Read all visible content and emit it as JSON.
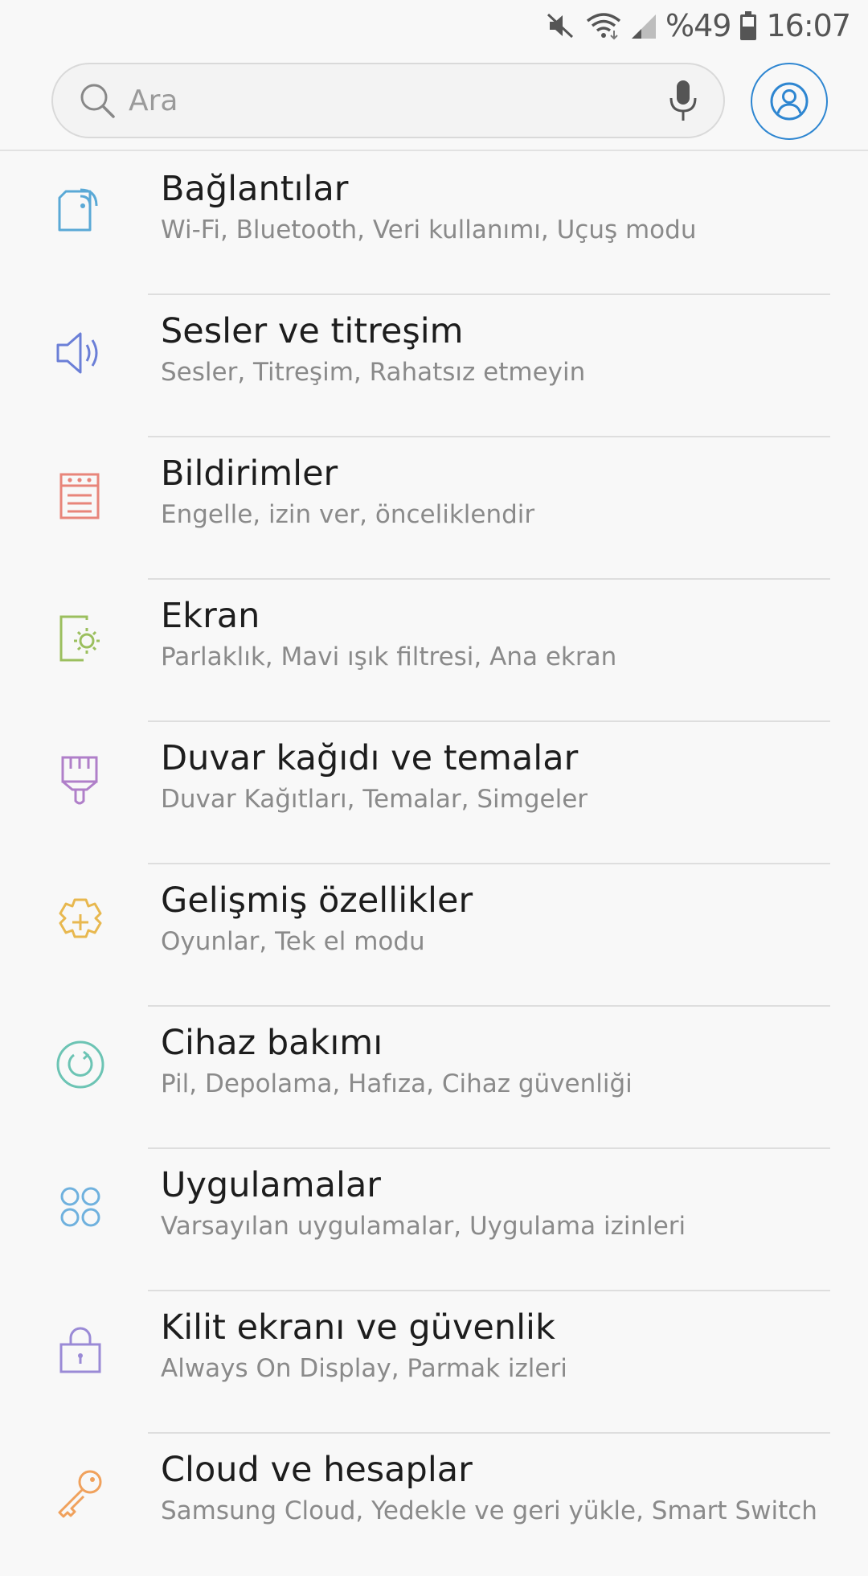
{
  "status_bar": {
    "battery_text": "%49",
    "time": "16:07",
    "icons": [
      "mute-icon",
      "wifi-icon",
      "signal-icon",
      "battery-icon"
    ]
  },
  "search": {
    "placeholder": "Ara",
    "icons": [
      "search-icon",
      "microphone-icon",
      "account-icon"
    ]
  },
  "colors": {
    "accent": "#2e86d1",
    "connections": "#5aa9d6",
    "sounds": "#6b7fd7",
    "notifications": "#e8857a",
    "display": "#9bbf5e",
    "wallpapers": "#b07fc9",
    "advanced": "#e8b84f",
    "device_care": "#6cc4b4",
    "apps": "#6fb1de",
    "lock_screen": "#9a8ad6",
    "cloud": "#f0a15c"
  },
  "settings": {
    "items": [
      {
        "title": "Bağlantılar",
        "subtitle": "Wi-Fi, Bluetooth, Veri kullanımı, Uçuş modu",
        "icon": "connections-icon"
      },
      {
        "title": "Sesler ve titreşim",
        "subtitle": "Sesler, Titreşim, Rahatsız etmeyin",
        "icon": "speaker-icon"
      },
      {
        "title": "Bildirimler",
        "subtitle": "Engelle, izin ver, önceliklendir",
        "icon": "notifications-icon"
      },
      {
        "title": "Ekran",
        "subtitle": "Parlaklık, Mavi ışık filtresi, Ana ekran",
        "icon": "display-brightness-icon"
      },
      {
        "title": "Duvar kağıdı ve temalar",
        "subtitle": "Duvar Kağıtları, Temalar, Simgeler",
        "icon": "paintbrush-icon"
      },
      {
        "title": "Gelişmiş özellikler",
        "subtitle": "Oyunlar, Tek el modu",
        "icon": "gear-plus-icon"
      },
      {
        "title": "Cihaz bakımı",
        "subtitle": "Pil, Depolama, Hafıza, Cihaz güvenliği",
        "icon": "device-care-icon"
      },
      {
        "title": "Uygulamalar",
        "subtitle": "Varsayılan uygulamalar, Uygulama izinleri",
        "icon": "apps-grid-icon"
      },
      {
        "title": "Kilit ekranı ve güvenlik",
        "subtitle": "Always On Display, Parmak izleri",
        "icon": "lock-icon"
      },
      {
        "title": "Cloud ve hesaplar",
        "subtitle": "Samsung Cloud, Yedekle ve geri yükle, Smart Switch",
        "icon": "key-icon"
      }
    ]
  }
}
